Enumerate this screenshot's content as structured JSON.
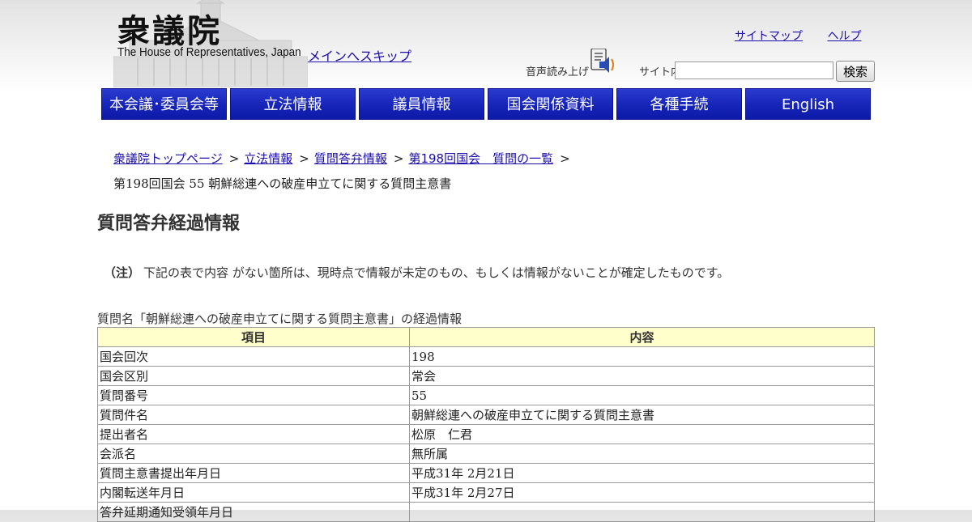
{
  "header": {
    "logo_jp": "衆議院",
    "logo_en": "The House of Representatives, Japan",
    "skip_link": "メインへスキップ",
    "sitemap": "サイトマップ",
    "help": "ヘルプ",
    "voice_label": "音声読み上げ",
    "search_label": "サイト内",
    "search_value": "",
    "search_button": "検索"
  },
  "nav": [
    {
      "label": "本会議･委員会等"
    },
    {
      "label": "立法情報"
    },
    {
      "label": "議員情報"
    },
    {
      "label": "国会関係資料"
    },
    {
      "label": "各種手続"
    },
    {
      "label": "English"
    }
  ],
  "breadcrumb": {
    "items": [
      "衆議院トップページ",
      "立法情報",
      "質問答弁情報",
      "第198回国会　質問の一覧"
    ],
    "separator": ">",
    "current": "第198回国会 55 朝鮮総連への破産申立てに関する質問主意書"
  },
  "page_title": "質問答弁経過情報",
  "note": {
    "prefix": "（注）",
    "text": "下記の表で内容 がない箇所は、現時点で情報が未定のもの、もしくは情報がないことが確定したものです。"
  },
  "table": {
    "caption": "質問名「朝鮮総連への破産申立てに関する質問主意書」の経過情報",
    "headers": [
      "項目",
      "内容"
    ],
    "rows": [
      [
        "国会回次",
        "198"
      ],
      [
        "国会区別",
        "常会"
      ],
      [
        "質問番号",
        "55"
      ],
      [
        "質問件名",
        "朝鮮総連への破産申立てに関する質問主意書"
      ],
      [
        "提出者名",
        "松原　仁君"
      ],
      [
        "会派名",
        "無所属"
      ],
      [
        "質問主意書提出年月日",
        "平成31年 2月21日"
      ],
      [
        "内閣転送年月日",
        "平成31年 2月27日"
      ],
      [
        "答弁延期通知受領年月日",
        ""
      ]
    ]
  }
}
